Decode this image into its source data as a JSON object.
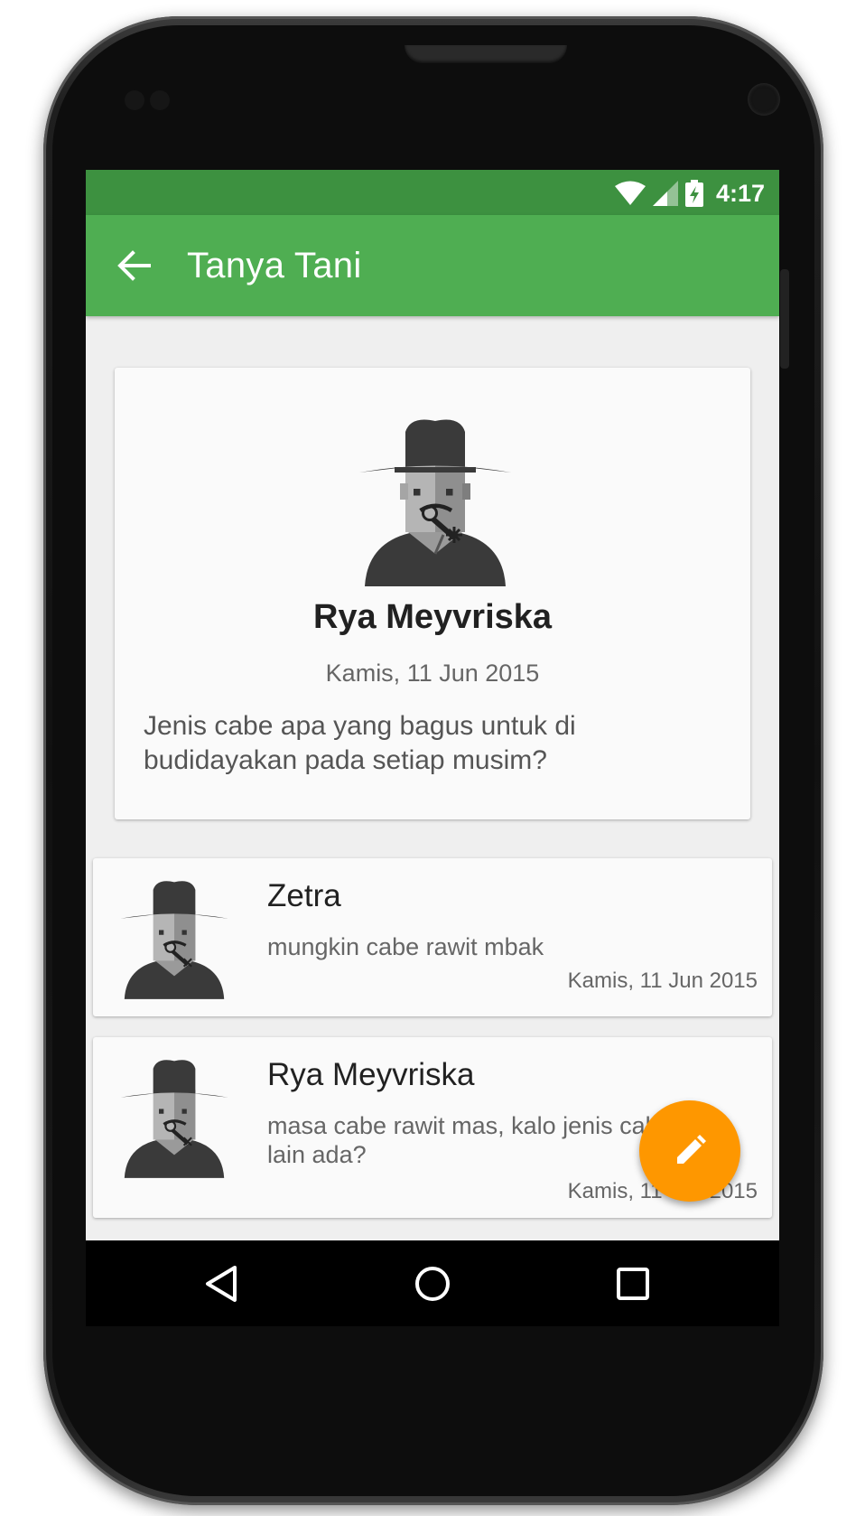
{
  "status_bar": {
    "time": "4:17",
    "icons": [
      "wifi-icon",
      "signal-icon",
      "battery-charging-icon"
    ],
    "color": "#3d9140"
  },
  "app_bar": {
    "title": "Tanya Tani",
    "back_icon": "arrow-back-icon",
    "color": "#4fae52"
  },
  "question": {
    "author": "Rya Meyvriska",
    "date": "Kamis, 11 Jun 2015",
    "text": "Jenis cabe apa yang bagus untuk di budidayakan pada setiap musim?"
  },
  "answers": [
    {
      "author": "Zetra",
      "text": "mungkin cabe rawit mbak",
      "date": "Kamis, 11 Jun 2015"
    },
    {
      "author": "Rya Meyvriska",
      "text": "masa cabe rawit mas, kalo jenis cabe yang lain ada?",
      "date": "Kamis, 11 Jun 2015"
    }
  ],
  "fab": {
    "icon": "pencil-icon",
    "color": "#fe9700"
  },
  "nav_bar": {
    "icons": [
      "back-triangle-icon",
      "home-circle-icon",
      "recents-square-icon"
    ]
  }
}
